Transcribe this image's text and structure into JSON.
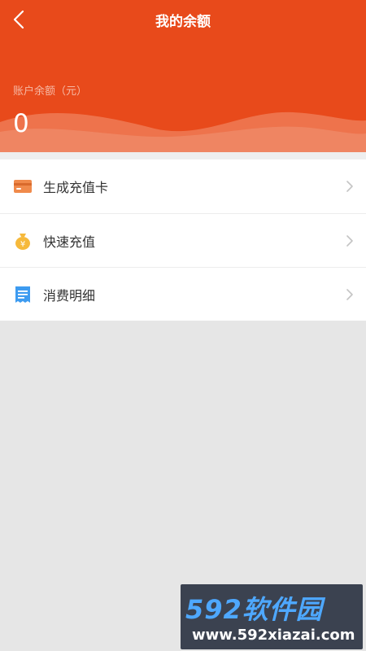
{
  "header": {
    "title": "我的余额",
    "back_icon": "chevron-left-icon",
    "background_color": "#e84a1b"
  },
  "balance": {
    "label": "账户余额（元）",
    "value": "0"
  },
  "menu": {
    "items": [
      {
        "label": "生成充值卡",
        "icon": "card-icon",
        "icon_color": "#f08a4b"
      },
      {
        "label": "快速充值",
        "icon": "money-bag-icon",
        "icon_color": "#f6b93b"
      },
      {
        "label": "消费明细",
        "icon": "receipt-icon",
        "icon_color": "#3d9bf0"
      }
    ],
    "chevron_icon": "chevron-right-icon"
  },
  "watermark": {
    "brand": "592软件园",
    "url": "www.592xiazai.com"
  }
}
